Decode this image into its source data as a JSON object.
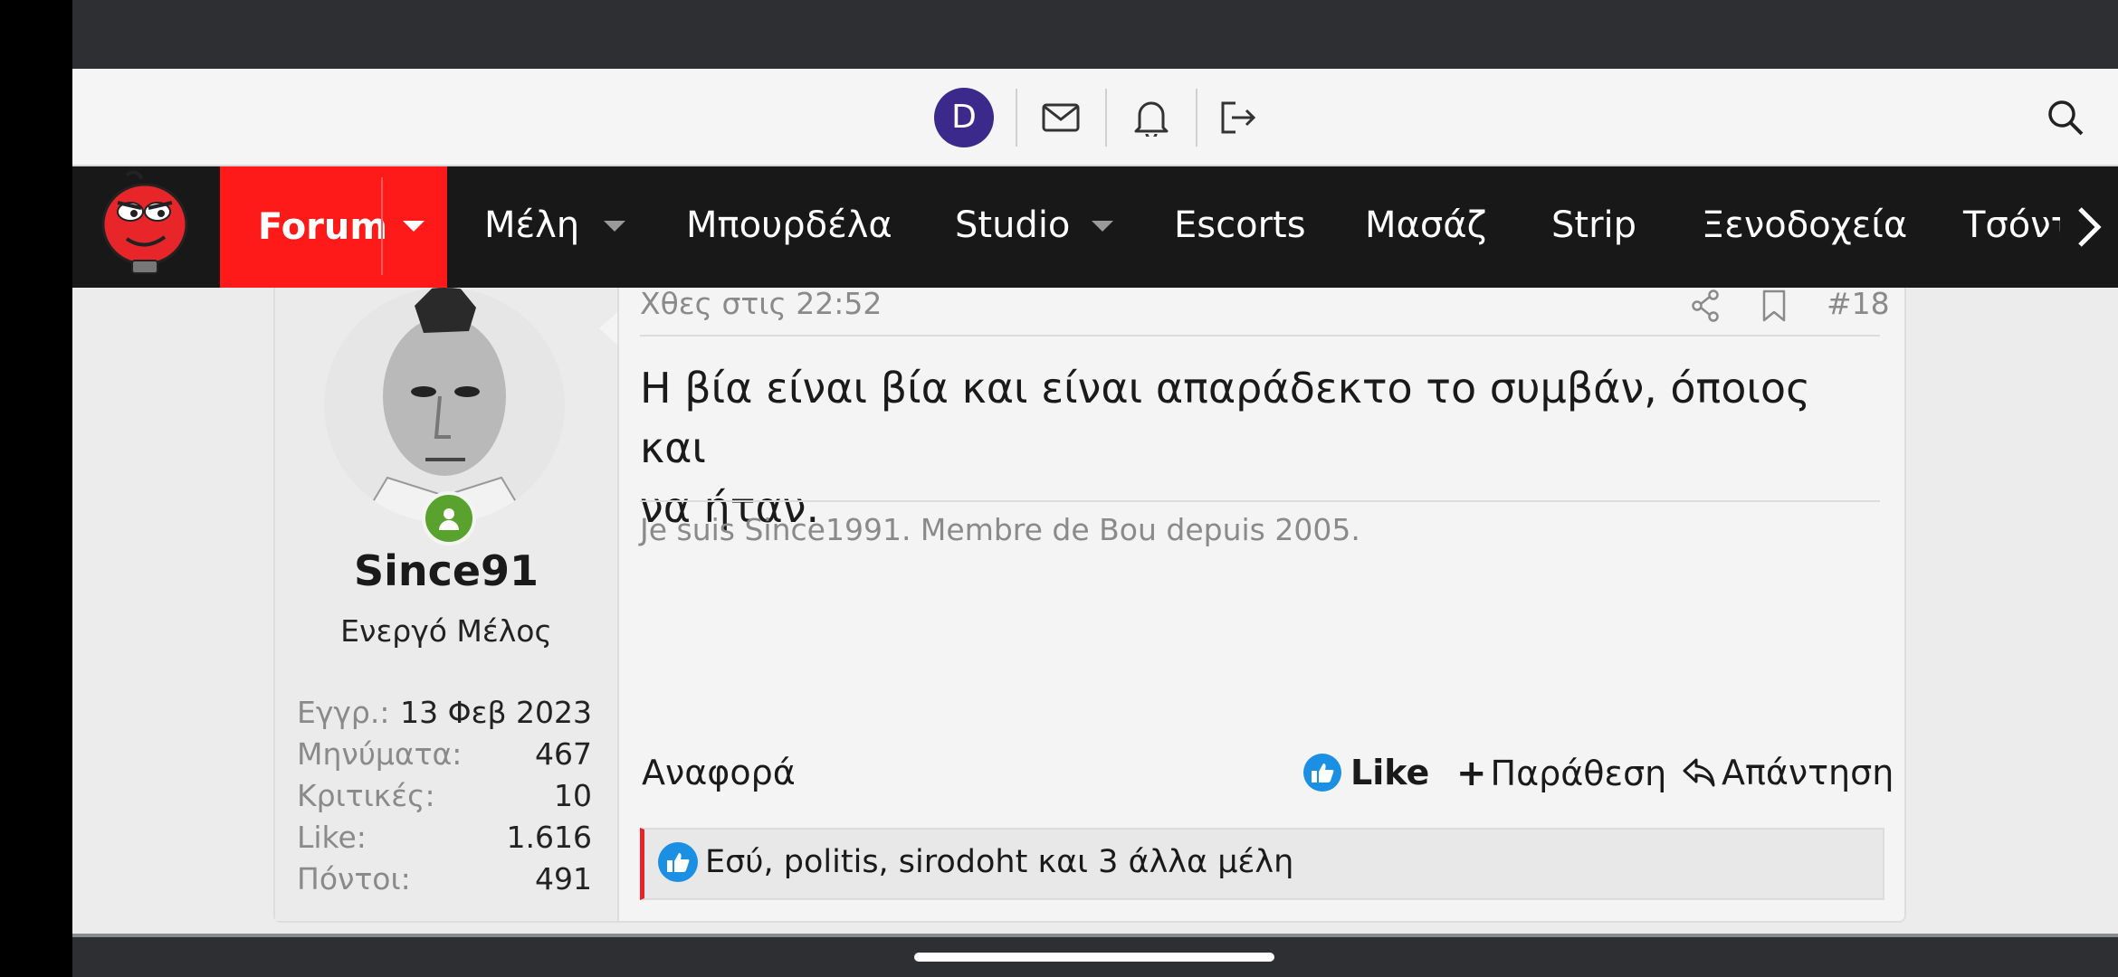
{
  "top_bar": {
    "avatar_letter": "D",
    "icons": [
      "mail-icon",
      "bell-icon",
      "logout-icon",
      "search-icon"
    ]
  },
  "nav": {
    "items": [
      {
        "label": "Forum",
        "active": true,
        "dropdown": true
      },
      {
        "label": "Μέλη",
        "dropdown": true
      },
      {
        "label": "Μπουρδέλα"
      },
      {
        "label": "Studio",
        "dropdown": true
      },
      {
        "label": "Escorts"
      },
      {
        "label": "Μασάζ"
      },
      {
        "label": "Strip"
      },
      {
        "label": "Ξενοδοχεία"
      },
      {
        "label": "Τσόντ"
      }
    ],
    "accent": "#ff1a1a"
  },
  "user": {
    "name": "Since91",
    "title": "Ενεργό Μέλος",
    "online_color": "#5aa22e",
    "stats": [
      {
        "label": "Εγγρ.:",
        "value": "13 Φεβ 2023"
      },
      {
        "label": "Μηνύματα:",
        "value": "467"
      },
      {
        "label": "Κριτικές:",
        "value": "10"
      },
      {
        "label": "Like:",
        "value": "1.616"
      },
      {
        "label": "Πόντοι:",
        "value": "491"
      }
    ]
  },
  "post": {
    "date": "Χθες στις 22:52",
    "number": "#18",
    "body_line1": "Η βία είναι βία και είναι απαράδεκτο το συμβάν, όποιος και",
    "body_line2": "να ήταν.",
    "signature": "Je suis Since1991. Membre de Bou depuis 2005.",
    "actions": {
      "report": "Αναφορά",
      "like": "Like",
      "quote": "Παράθεση",
      "reply": "Απάντηση"
    },
    "likes_text": "Εσύ, politis, sirodoht και 3 άλλα μέλη",
    "like_color": "#1a8fe3"
  }
}
